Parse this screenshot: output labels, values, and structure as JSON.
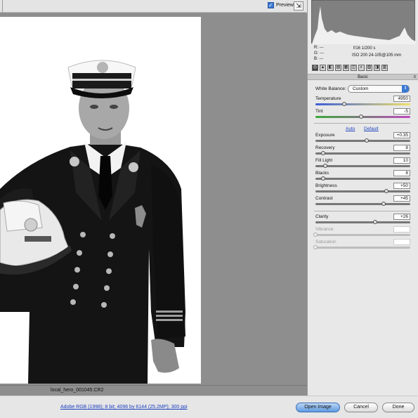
{
  "toolbar": {
    "preview_label": "Preview",
    "preview_checked": "✓",
    "fullscreen_icon": "fullscreen-toggle-icon"
  },
  "canvas": {
    "filename": "local_hero_001045.CR2"
  },
  "bottom": {
    "workflow": "Adobe RGB (1998); 8 bit; 4096 by 6144 (25.2MP); 300 ppi",
    "open_label": "Open Image",
    "cancel_label": "Cancel",
    "done_label": "Done"
  },
  "readout": {
    "r": "R:  ---",
    "g": "G:  ---",
    "b": "B:  ---",
    "exposure": "f/16    1/200 s",
    "iso": "ISO 200    24-105@105 mm"
  },
  "panel": {
    "title": "Basic",
    "menu_icon": "≡",
    "tabs": [
      "◎",
      "▲",
      "◧",
      "▤",
      "▦",
      "◫",
      "◐",
      "▧",
      "◨",
      "▥"
    ],
    "white_balance_label": "White Balance:",
    "white_balance_value": "Custom",
    "auto_label": "Auto",
    "default_label": "Default",
    "sliders": [
      {
        "label": "Temperature",
        "value": "4950",
        "level": 0.3
      },
      {
        "label": "Tint",
        "value": "-5",
        "level": 0.48
      },
      {
        "label": "Exposure",
        "value": "+0.35",
        "level": 0.54
      },
      {
        "label": "Recovery",
        "value": "8",
        "level": 0.08
      },
      {
        "label": "Fill Light",
        "value": "10",
        "level": 0.1
      },
      {
        "label": "Blacks",
        "value": "8",
        "level": 0.08
      },
      {
        "label": "Brightness",
        "value": "+50",
        "level": 0.75
      },
      {
        "label": "Contrast",
        "value": "+45",
        "level": 0.72
      },
      {
        "label": "Clarity",
        "value": "+26",
        "level": 0.63
      },
      {
        "label": "Vibrance",
        "value": "",
        "level": 0.0
      },
      {
        "label": "Saturation",
        "value": "",
        "level": 0.0
      }
    ]
  },
  "colors": {
    "accent": "#3a78d4",
    "link": "#1a3fbf",
    "canvas_bg": "#8e8e8e"
  }
}
